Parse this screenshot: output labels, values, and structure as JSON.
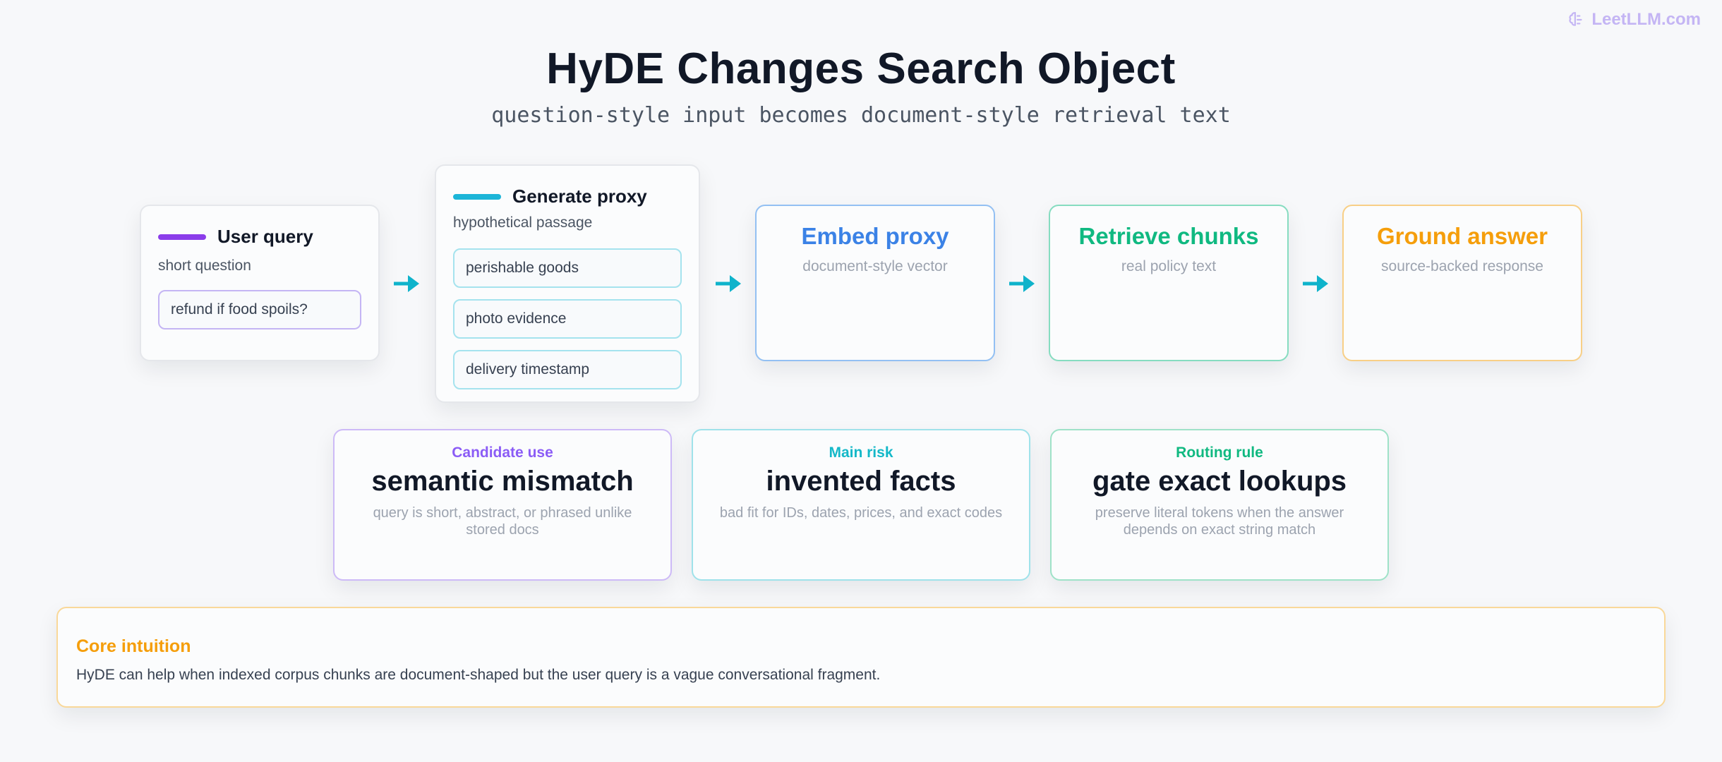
{
  "brand": {
    "name": "LeetLLM.com",
    "icon": "brain-icon"
  },
  "title": "HyDE Changes Search Object",
  "subtitle": "question-style input becomes document-style retrieval text",
  "flow": {
    "user_query": {
      "label": "User query",
      "sublabel": "short question",
      "example": "refund if food spoils?",
      "accent": "#8b3dea"
    },
    "generate_proxy": {
      "label": "Generate proxy",
      "sublabel": "hypothetical passage",
      "items": [
        "perishable goods",
        "photo evidence",
        "delivery timestamp"
      ],
      "accent": "#1cb5d8"
    },
    "stages": [
      {
        "title": "Embed proxy",
        "subtitle": "document-style vector",
        "color": "#3b82e6"
      },
      {
        "title": "Retrieve chunks",
        "subtitle": "real policy text",
        "color": "#10b981"
      },
      {
        "title": "Ground answer",
        "subtitle": "source-backed response",
        "color": "#f59e0b"
      }
    ],
    "arrow_color": "#0fb3cb"
  },
  "info_cards": [
    {
      "kicker": "Candidate use",
      "headline": "semantic mismatch",
      "description": "query is short, abstract, or phrased unlike stored docs",
      "color": "#8b5cf6"
    },
    {
      "kicker": "Main risk",
      "headline": "invented facts",
      "description": "bad fit for IDs, dates, prices, and exact codes",
      "color": "#14b8c8"
    },
    {
      "kicker": "Routing rule",
      "headline": "gate exact lookups",
      "description": "preserve literal tokens when the answer depends on exact string match",
      "color": "#10b981"
    }
  ],
  "core": {
    "title": "Core intuition",
    "text": "HyDE can help when indexed corpus chunks are document-shaped but the user query is a vague conversational fragment."
  }
}
